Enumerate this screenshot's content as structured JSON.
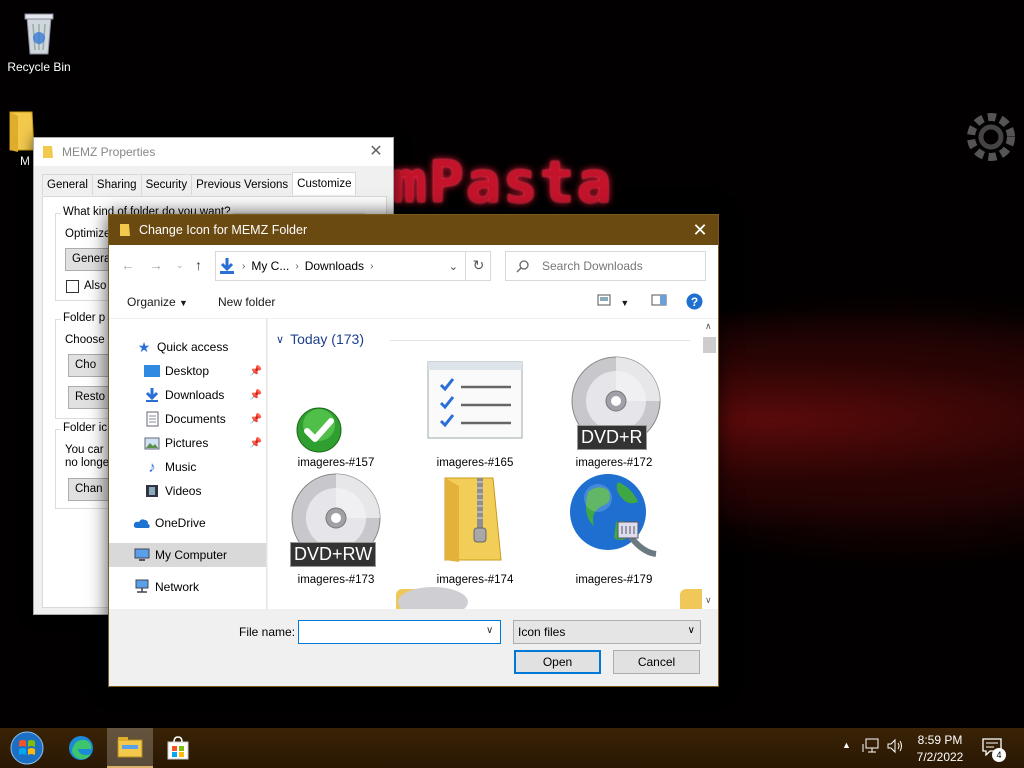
{
  "desktop": {
    "icons": [
      {
        "label": "Recycle Bin",
        "icon": "recycle-bin-icon"
      },
      {
        "label": "M",
        "icon": "folder-icon"
      }
    ],
    "wallpaper_text": "mPasta"
  },
  "properties_window": {
    "title": "MEMZ Properties",
    "tabs": [
      "General",
      "Sharing",
      "Security",
      "Previous Versions",
      "Customize"
    ],
    "active_tab": "Customize",
    "group1_title": "What kind of folder do you want?",
    "optimize_label": "Optimize",
    "optimize_value": "Genera",
    "also_apply_label": "Also",
    "group2_title": "Folder p",
    "choose_label": "Choose",
    "choose_button": "Cho",
    "restore_button": "Resto",
    "group3_title": "Folder ic",
    "group3_text1": "You car",
    "group3_text2": "no longe",
    "change_icon_button": "Chan"
  },
  "dialog": {
    "title": "Change Icon for MEMZ Folder",
    "close": "✕",
    "address": {
      "segments": [
        "My C...",
        "Downloads"
      ]
    },
    "search_placeholder": "Search Downloads",
    "commands": {
      "organize": "Organize",
      "new_folder": "New folder"
    },
    "nav": {
      "quick_access": "Quick access",
      "items": [
        {
          "label": "Desktop",
          "pinned": true
        },
        {
          "label": "Downloads",
          "pinned": true
        },
        {
          "label": "Documents",
          "pinned": true
        },
        {
          "label": "Pictures",
          "pinned": true
        },
        {
          "label": "Music",
          "pinned": false
        },
        {
          "label": "Videos",
          "pinned": false
        }
      ],
      "onedrive": "OneDrive",
      "my_computer": "My Computer",
      "network": "Network"
    },
    "group_header": "Today (173)",
    "files": [
      {
        "label": "imageres-#157",
        "icon": "checkmark-icon"
      },
      {
        "label": "imageres-#165",
        "icon": "checklist-icon"
      },
      {
        "label": "imageres-#172",
        "icon": "dvd-r-icon",
        "badge": "DVD+R"
      },
      {
        "label": "imageres-#173",
        "icon": "dvd-rw-icon",
        "badge": "DVD+RW"
      },
      {
        "label": "imageres-#174",
        "icon": "zip-folder-icon"
      },
      {
        "label": "imageres-#179",
        "icon": "network-globe-icon"
      }
    ],
    "file_name_label": "File name:",
    "file_name_value": "",
    "file_type": "Icon files",
    "open_button": "Open",
    "cancel_button": "Cancel"
  },
  "taskbar": {
    "time": "8:59 PM",
    "date": "7/2/2022",
    "notification_count": "4"
  }
}
